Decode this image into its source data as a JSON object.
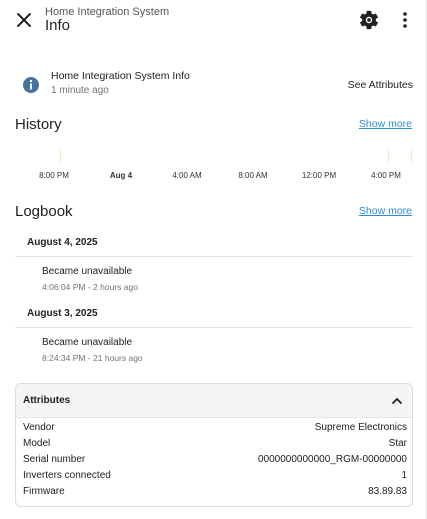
{
  "header": {
    "subtitle": "Home Integration System",
    "title": "Info"
  },
  "info": {
    "name": "Home Integration System Info",
    "time": "1 minute ago",
    "see_attributes": "See Attributes"
  },
  "history": {
    "title": "History",
    "show_more": "Show more",
    "labels": [
      "8:00 PM",
      "Aug 4",
      "4:00 AM",
      "8:00 AM",
      "12:00 PM",
      "4:00 PM"
    ]
  },
  "logbook": {
    "title": "Logbook",
    "show_more": "Show more",
    "groups": [
      {
        "date": "August 4, 2025",
        "message": "Became unavailable",
        "time": "4:06:04 PM - 2 hours ago"
      },
      {
        "date": "August 3, 2025",
        "message": "Became unavailable",
        "time": "8:24:34 PM - 21 hours ago"
      }
    ]
  },
  "attributes": {
    "title": "Attributes",
    "rows": [
      {
        "key": "Vendor",
        "value": "Supreme Electronics"
      },
      {
        "key": "Model",
        "value": "Star"
      },
      {
        "key": "Serial number",
        "value": "0000000000000_RGM-00000000"
      },
      {
        "key": "Inverters connected",
        "value": "1"
      },
      {
        "key": "Firmware",
        "value": "83.89.83"
      }
    ]
  },
  "colors": {
    "accent": "#2b8fd6",
    "info_icon": "#44739e",
    "timeline_tick": "#f0ebb8"
  },
  "icons": [
    "close-icon",
    "gear-icon",
    "more-vertical-icon",
    "info-icon",
    "chevron-up-icon"
  ]
}
